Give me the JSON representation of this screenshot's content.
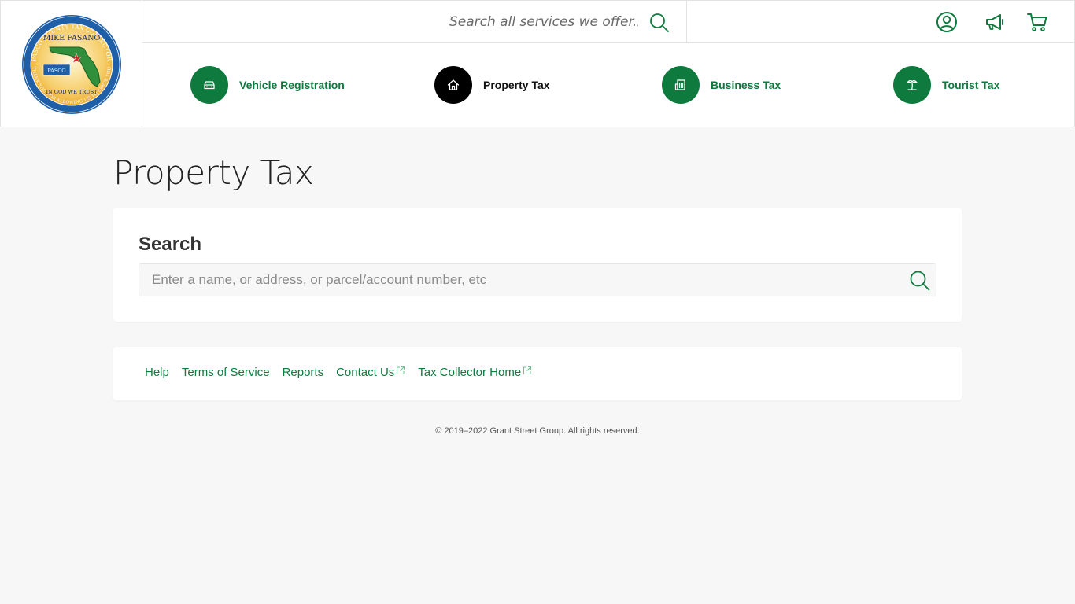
{
  "logo": {
    "ring_top_text": "PASCO COUNTY TAX COLLECTOR",
    "name": "MIKE FASANO",
    "county": "PASCO",
    "motto": "IN GOD WE TRUST",
    "ring_bottom_text": "THANK YOU FOR ALLOWING US TO SERVE YOU",
    "colors": {
      "ring": "#1f5fa8",
      "inner": "#f5c04a",
      "state": "#2f8f3a"
    }
  },
  "header": {
    "service_search_placeholder": "Search all services we offer...",
    "icons": [
      "account-icon",
      "megaphone-icon",
      "cart-icon"
    ]
  },
  "nav": {
    "items": [
      {
        "label": "Vehicle Registration",
        "icon": "car-icon",
        "active": false
      },
      {
        "label": "Property Tax",
        "icon": "house-icon",
        "active": true
      },
      {
        "label": "Business Tax",
        "icon": "building-icon",
        "active": false
      },
      {
        "label": "Tourist Tax",
        "icon": "palm-tree-icon",
        "active": false
      }
    ]
  },
  "main": {
    "title": "Property Tax",
    "search": {
      "heading": "Search",
      "placeholder": "Enter a name, or address, or parcel/account number, etc"
    }
  },
  "footer": {
    "links": [
      {
        "label": "Help",
        "external": false
      },
      {
        "label": "Terms of Service",
        "external": false
      },
      {
        "label": "Reports",
        "external": false
      },
      {
        "label": "Contact Us",
        "external": true
      },
      {
        "label": "Tax Collector Home",
        "external": true
      }
    ],
    "copyright": "© 2019–2022 Grant Street Group. All rights reserved."
  },
  "colors": {
    "brand_green": "#0e7a3e",
    "active_nav": "#000000",
    "background": "#f7f7f7"
  }
}
